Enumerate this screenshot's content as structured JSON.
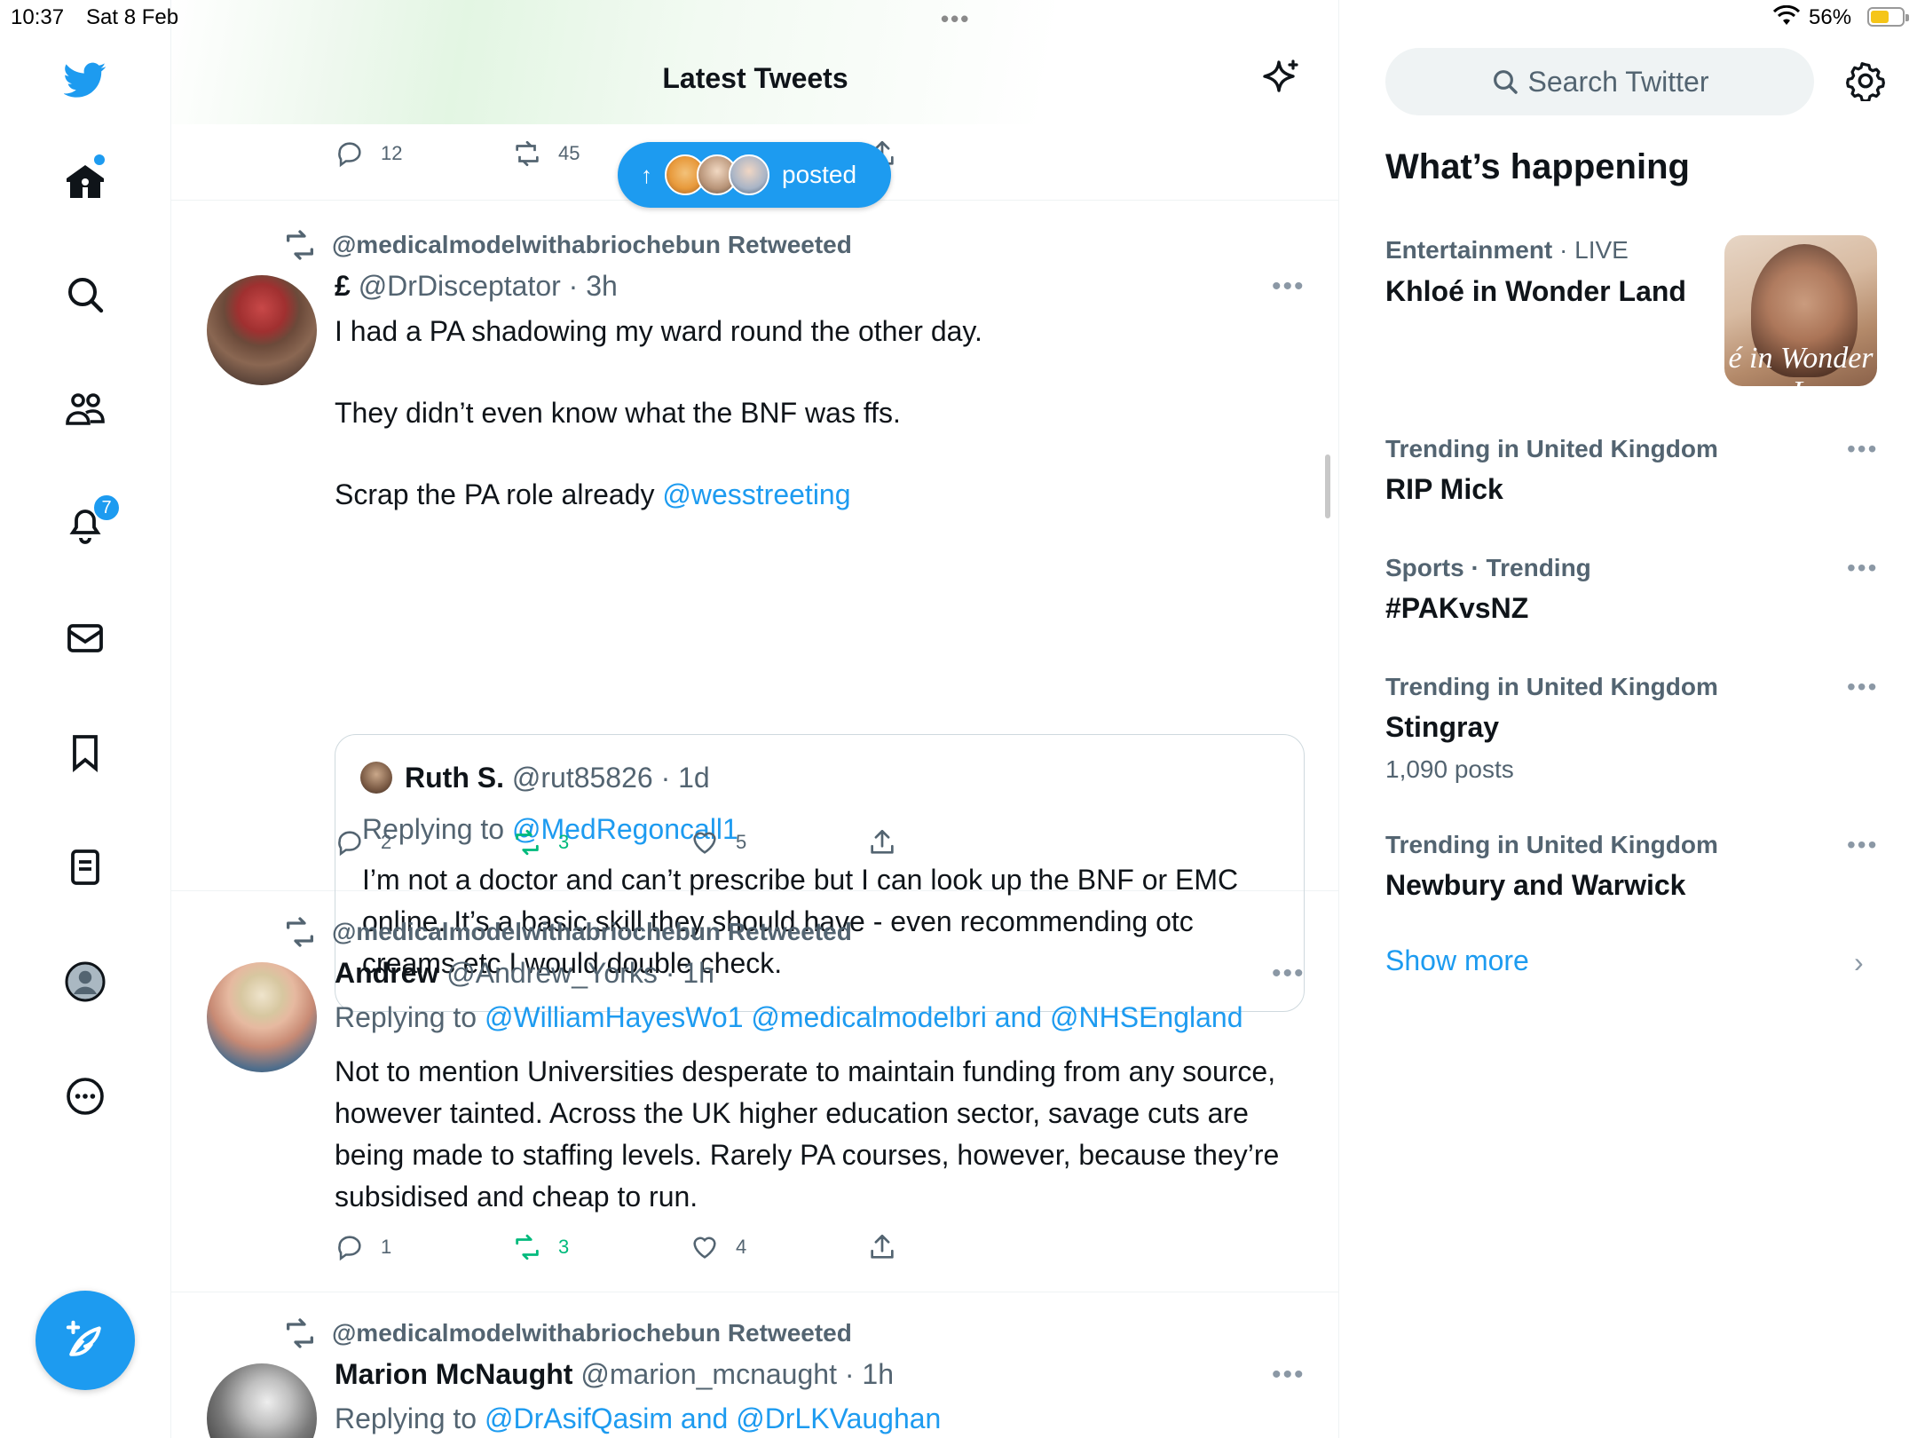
{
  "status_bar": {
    "time": "10:37",
    "date": "Sat 8 Feb",
    "battery_pct": "56%",
    "battery_level": 0.56
  },
  "nav": {
    "notifications_badge": "7",
    "items": [
      "twitter-logo-icon",
      "home-icon",
      "search-icon",
      "communities-icon",
      "notifications-icon",
      "messages-icon",
      "bookmarks-icon",
      "lists-icon",
      "profile-icon",
      "more-icon"
    ]
  },
  "header": {
    "title": "Latest Tweets"
  },
  "top_tweet_actions": {
    "replies": "12",
    "retweets": "45"
  },
  "posted_pill": {
    "label": "posted"
  },
  "tweets": [
    {
      "retweeted_by": "@medicalmodelwithabriochebun Retweeted",
      "name": "£",
      "handle": "@DrDisceptator",
      "time": "· 3h",
      "body_1": "I had a PA shadowing my ward round the other day.",
      "body_2": "They didn’t even know what the BNF was ffs.",
      "body_3": "Scrap the PA role already ",
      "body_link": "@wesstreeting",
      "quote": {
        "name": "Ruth S.",
        "handle": "@rut85826",
        "time": "· 1d",
        "replying_label": "Replying to ",
        "replying_to": "@MedRegoncall1",
        "body": "I’m not a doctor and can’t prescribe but I can look up the BNF or EMC online. It’s a basic skill they should have - even recommending otc creams etc I would double check."
      },
      "replies": "2",
      "retweets": "3",
      "likes": "5"
    },
    {
      "retweeted_by": "@medicalmodelwithabriochebun Retweeted",
      "name": "Andrew",
      "handle": "@Andrew_Yorks",
      "time": "· 1h",
      "replying_label": "Replying to ",
      "replying_to_1": "@WilliamHayesWo1",
      "replying_to_2": "@medicalmodelbri",
      "replying_and": " and ",
      "replying_to_3": "@NHSEngland",
      "body": "Not to mention Universities desperate to maintain funding from any source, however tainted. Across the UK higher education sector, savage cuts are being made to staffing levels. Rarely PA courses, however, because they’re subsidised and cheap to run.",
      "replies": "1",
      "retweets": "3",
      "likes": "4"
    },
    {
      "retweeted_by": "@medicalmodelwithabriochebun Retweeted",
      "name": "Marion McNaught",
      "handle": "@marion_mcnaught",
      "time": "· 1h",
      "replying_label": "Replying to ",
      "replying_to_1": "@DrAsifQasim",
      "replying_and": " and ",
      "replying_to_2": "@DrLKVaughan"
    }
  ],
  "sidebar": {
    "search_placeholder": "Search Twitter",
    "whats_happening": "What’s happening",
    "trends": [
      {
        "context": "Entertainment",
        "context_extra": " · LIVE",
        "name": "Khloé in Wonder Land",
        "image_caption": "é in Wonder L"
      },
      {
        "context": "Trending in United Kingdom",
        "name": "RIP Mick"
      },
      {
        "context": "Sports · Trending",
        "name": "#PAKvsNZ"
      },
      {
        "context": "Trending in United Kingdom",
        "name": "Stingray",
        "posts": "1,090 posts"
      },
      {
        "context": "Trending in United Kingdom",
        "name": "Newbury and Warwick"
      }
    ],
    "show_more": "Show more"
  },
  "colors": {
    "accent": "#1d9bf0",
    "retweet_green": "#00ba7c",
    "muted": "#536471",
    "text": "#0f1419"
  }
}
